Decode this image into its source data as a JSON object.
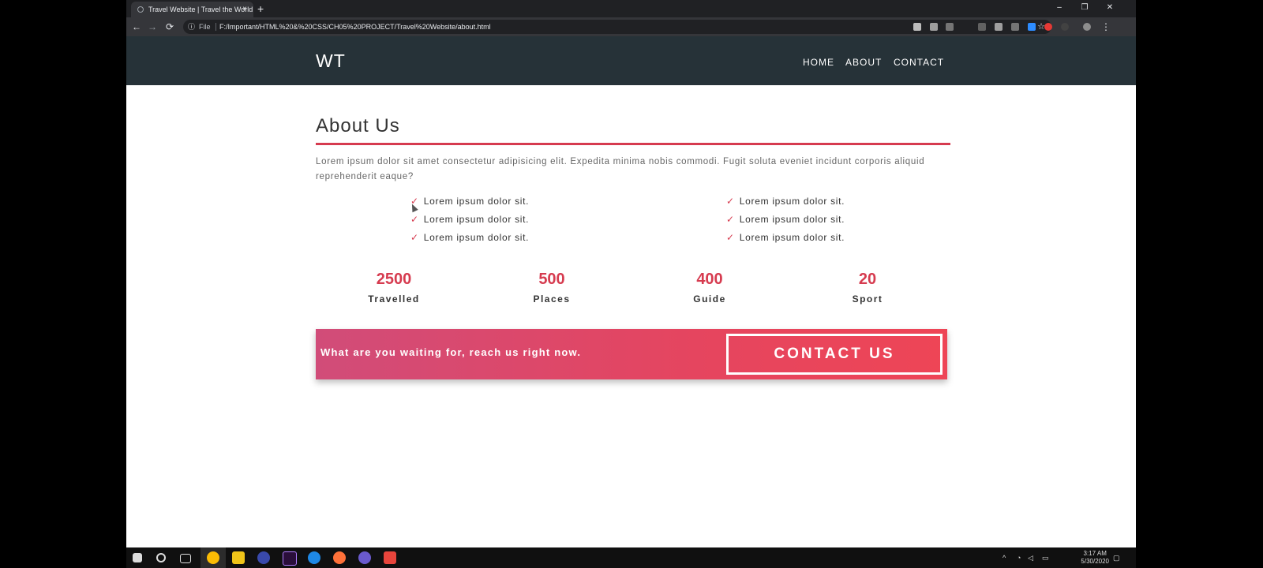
{
  "browser": {
    "tab_title": "Travel Website | Travel the World",
    "tab_close": "×",
    "new_tab": "+",
    "url_prefix": "File",
    "url": "F:/Important/HTML%20&%20CSS/CH05%20PROJECT/Travel%20Website/about.html",
    "star": "☆",
    "minimize": "–",
    "restore": "❐",
    "close": "✕",
    "back": "←",
    "forward": "→",
    "reload": "⟳",
    "info": "ⓘ",
    "menu": "⋮"
  },
  "site": {
    "logo": "WT",
    "nav": [
      "HOME",
      "ABOUT",
      "CONTACT"
    ]
  },
  "about": {
    "title": "About Us",
    "intro": "Lorem ipsum dolor sit amet consectetur adipisicing elit. Expedita minima nobis commodi. Fugit soluta eveniet incidunt corporis aliquid reprehenderit eaque?",
    "checkmark": "✓",
    "checklist_left": [
      "Lorem ipsum dolor sit.",
      "Lorem ipsum dolor sit.",
      "Lorem ipsum dolor sit."
    ],
    "checklist_right": [
      "Lorem ipsum dolor sit.",
      "Lorem ipsum dolor sit.",
      "Lorem ipsum dolor sit."
    ],
    "accent_color": "#d63b4f"
  },
  "stats": [
    {
      "number": "2500",
      "label": "Travelled"
    },
    {
      "number": "500",
      "label": "Places"
    },
    {
      "number": "400",
      "label": "Guide"
    },
    {
      "number": "20",
      "label": "Sport"
    }
  ],
  "cta": {
    "text": "What are you waiting for, reach us right now.",
    "button": "CONTACT US"
  },
  "taskbar": {
    "time": "3:17 AM",
    "date": "5/30/2020"
  }
}
